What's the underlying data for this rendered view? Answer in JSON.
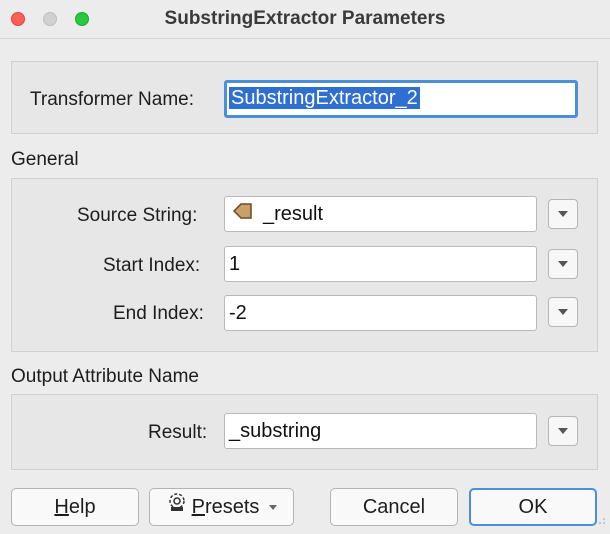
{
  "window": {
    "title": "SubstringExtractor Parameters"
  },
  "transformer": {
    "label": "Transformer Name:",
    "value": "SubstringExtractor_2"
  },
  "general": {
    "section_label": "General",
    "source_string": {
      "label": "Source String:",
      "value": "_result",
      "icon": "attribute-arrow-icon"
    },
    "start_index": {
      "label": "Start Index:",
      "value": "1"
    },
    "end_index": {
      "label": "End Index:",
      "value": "-2"
    }
  },
  "output": {
    "section_label": "Output Attribute Name",
    "result": {
      "label": "Result:",
      "value": "_substring"
    }
  },
  "buttons": {
    "help": "Help",
    "presets": "Presets",
    "cancel": "Cancel",
    "ok": "OK"
  },
  "colors": {
    "accent": "#4a90d9",
    "selection": "#2f6fd1",
    "close": "#fe5f57",
    "maximize": "#28c840"
  }
}
